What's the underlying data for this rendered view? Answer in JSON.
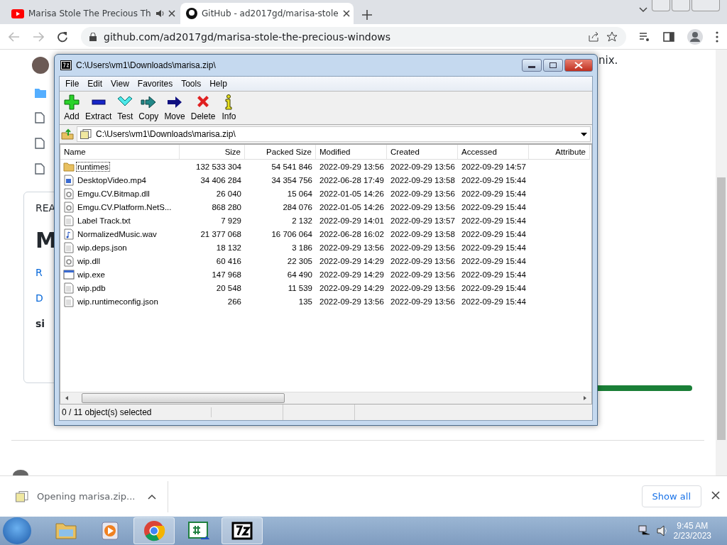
{
  "browser": {
    "tabs": [
      {
        "kind": "video",
        "title": "Marisa Stole The Precious Th",
        "audio": true,
        "selected": false
      },
      {
        "kind": "code",
        "title": "GitHub - ad2017gd/marisa-stole",
        "audio": false,
        "selected": true
      }
    ],
    "url": "github.com/ad2017gd/marisa-stole-the-precious-windows"
  },
  "page": {
    "left_fragments": [
      {
        "kind": "label",
        "text": "REA"
      },
      {
        "kind": "heading",
        "text": "M"
      },
      {
        "kind": "link",
        "text": "R"
      },
      {
        "kind": "link",
        "text": "D"
      },
      {
        "kind": "bold",
        "text": "si"
      }
    ],
    "right_text": "nix.",
    "progress": {
      "level": 1
    }
  },
  "archive_window": {
    "title": "C:\\Users\\vm1\\Downloads\\marisa.zip\\",
    "menu": [
      "File",
      "Edit",
      "View",
      "Favorites",
      "Tools",
      "Help"
    ],
    "toolbar": [
      {
        "kind": "add",
        "label": "Add"
      },
      {
        "kind": "extract",
        "label": "Extract"
      },
      {
        "kind": "test",
        "label": "Test"
      },
      {
        "kind": "copy",
        "label": "Copy"
      },
      {
        "kind": "move",
        "label": "Move"
      },
      {
        "kind": "delete",
        "label": "Delete"
      },
      {
        "kind": "info",
        "label": "Info"
      }
    ],
    "path": "C:\\Users\\vm1\\Downloads\\marisa.zip\\",
    "columns": [
      "Name",
      "Size",
      "Packed Size",
      "Modified",
      "Created",
      "Accessed",
      "Attribute"
    ],
    "rows": [
      {
        "kind": "folder",
        "focused": true,
        "cells": [
          "runtimes",
          "132 533 304",
          "54 541 846",
          "2022-09-29 13:56",
          "2022-09-29 13:56",
          "2022-09-29 14:57"
        ]
      },
      {
        "kind": "media",
        "focused": false,
        "cells": [
          "DesktopVideo.mp4",
          "34 406 284",
          "34 354 756",
          "2022-06-28 17:49",
          "2022-09-29 13:58",
          "2022-09-29 15:44"
        ]
      },
      {
        "kind": "library",
        "focused": false,
        "cells": [
          "Emgu.CV.Bitmap.dll",
          "26 040",
          "15 064",
          "2022-01-05 14:26",
          "2022-09-29 13:56",
          "2022-09-29 15:44"
        ]
      },
      {
        "kind": "library",
        "focused": false,
        "cells": [
          "Emgu.CV.Platform.NetS...",
          "868 280",
          "284 076",
          "2022-01-05 14:26",
          "2022-09-29 13:56",
          "2022-09-29 15:44"
        ]
      },
      {
        "kind": "text",
        "focused": false,
        "cells": [
          "Label Track.txt",
          "7 929",
          "2 132",
          "2022-09-29 14:01",
          "2022-09-29 13:57",
          "2022-09-29 15:44"
        ]
      },
      {
        "kind": "audio",
        "focused": false,
        "cells": [
          "NormalizedMusic.wav",
          "21 377 068",
          "16 706 064",
          "2022-06-28 16:02",
          "2022-09-29 13:58",
          "2022-09-29 15:44"
        ]
      },
      {
        "kind": "text",
        "focused": false,
        "cells": [
          "wip.deps.json",
          "18 132",
          "3 186",
          "2022-09-29 13:56",
          "2022-09-29 13:56",
          "2022-09-29 15:44"
        ]
      },
      {
        "kind": "library",
        "focused": false,
        "cells": [
          "wip.dll",
          "60 416",
          "22 305",
          "2022-09-29 14:29",
          "2022-09-29 13:56",
          "2022-09-29 15:44"
        ]
      },
      {
        "kind": "program",
        "focused": false,
        "cells": [
          "wip.exe",
          "147 968",
          "64 490",
          "2022-09-29 14:29",
          "2022-09-29 13:56",
          "2022-09-29 15:44"
        ]
      },
      {
        "kind": "text",
        "focused": false,
        "cells": [
          "wip.pdb",
          "20 548",
          "11 539",
          "2022-09-29 14:29",
          "2022-09-29 13:56",
          "2022-09-29 15:44"
        ]
      },
      {
        "kind": "text",
        "focused": false,
        "cells": [
          "wip.runtimeconfig.json",
          "266",
          "135",
          "2022-09-29 13:56",
          "2022-09-29 13:56",
          "2022-09-29 15:44"
        ]
      }
    ],
    "status": "0 / 11 object(s) selected"
  },
  "download_bar": {
    "item": "Opening marisa.zip...",
    "button": "Show all"
  },
  "taskbar": {
    "apps": [
      {
        "kind": "explorer",
        "selected": false
      },
      {
        "kind": "player",
        "selected": false
      },
      {
        "kind": "browser",
        "selected": true
      },
      {
        "kind": "csharp",
        "selected": false
      },
      {
        "kind": "archiver",
        "selected": true
      }
    ],
    "time": "9:45 AM",
    "date": "2/23/2023"
  }
}
